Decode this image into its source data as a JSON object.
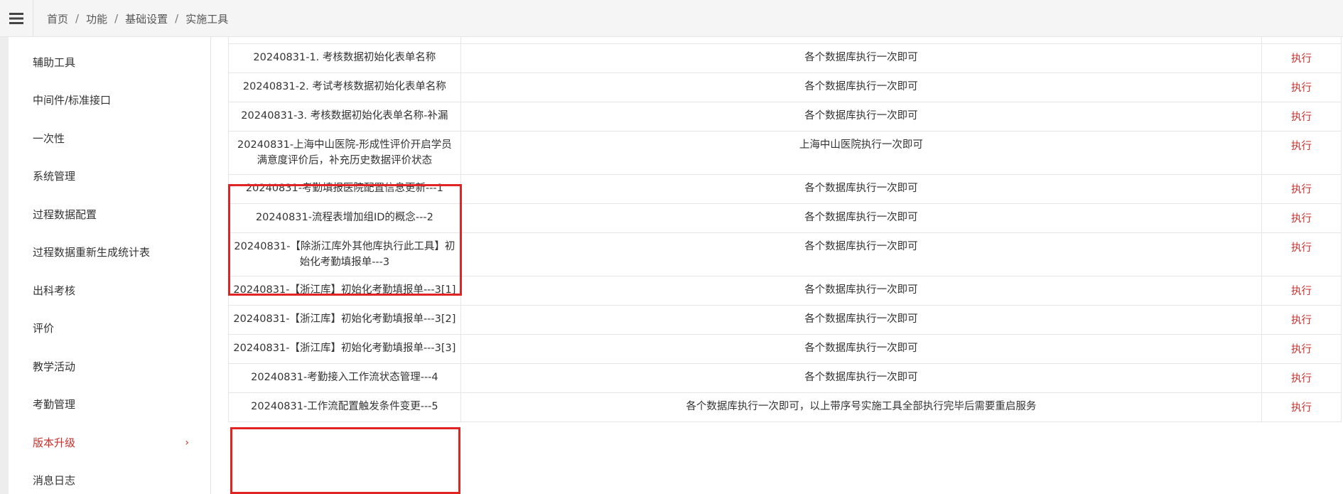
{
  "breadcrumb": [
    "首页",
    "功能",
    "基础设置",
    "实施工具"
  ],
  "sidebar": {
    "items": [
      {
        "label": "辅助工具",
        "active": false
      },
      {
        "label": "中间件/标准接口",
        "active": false
      },
      {
        "label": "一次性",
        "active": false
      },
      {
        "label": "系统管理",
        "active": false
      },
      {
        "label": "过程数据配置",
        "active": false
      },
      {
        "label": "过程数据重新生成统计表",
        "active": false
      },
      {
        "label": "出科考核",
        "active": false
      },
      {
        "label": "评价",
        "active": false
      },
      {
        "label": "教学活动",
        "active": false
      },
      {
        "label": "考勤管理",
        "active": false
      },
      {
        "label": "版本升级",
        "active": true
      },
      {
        "label": "消息日志",
        "active": false
      }
    ]
  },
  "table": {
    "action_label": "执行",
    "rows": [
      {
        "name": "20240831-1. 考核数据初始化表单名称",
        "desc": "各个数据库执行一次即可"
      },
      {
        "name": "20240831-2. 考试考核数据初始化表单名称",
        "desc": "各个数据库执行一次即可"
      },
      {
        "name": "20240831-3. 考核数据初始化表单名称-补漏",
        "desc": "各个数据库执行一次即可"
      },
      {
        "name": "20240831-上海中山医院-形成性评价开启学员满意度评价后，补充历史数据评价状态",
        "desc": "上海中山医院执行一次即可"
      },
      {
        "name": "20240831-考勤填报医院配置信息更新---1",
        "desc": "各个数据库执行一次即可"
      },
      {
        "name": "20240831-流程表增加组ID的概念---2",
        "desc": "各个数据库执行一次即可"
      },
      {
        "name": "20240831-【除浙江库外其他库执行此工具】初始化考勤填报单---3",
        "desc": "各个数据库执行一次即可"
      },
      {
        "name": "20240831-【浙江库】初始化考勤填报单---3[1]",
        "desc": "各个数据库执行一次即可"
      },
      {
        "name": "20240831-【浙江库】初始化考勤填报单---3[2]",
        "desc": "各个数据库执行一次即可"
      },
      {
        "name": "20240831-【浙江库】初始化考勤填报单---3[3]",
        "desc": "各个数据库执行一次即可"
      },
      {
        "name": "20240831-考勤接入工作流状态管理---4",
        "desc": "各个数据库执行一次即可"
      },
      {
        "name": "20240831-工作流配置触发条件变更---5",
        "desc": "各个数据库执行一次即可，以上带序号实施工具全部执行完毕后需要重启服务"
      }
    ]
  },
  "colors": {
    "accent": "#c9302c",
    "highlight_border": "#e02424"
  }
}
